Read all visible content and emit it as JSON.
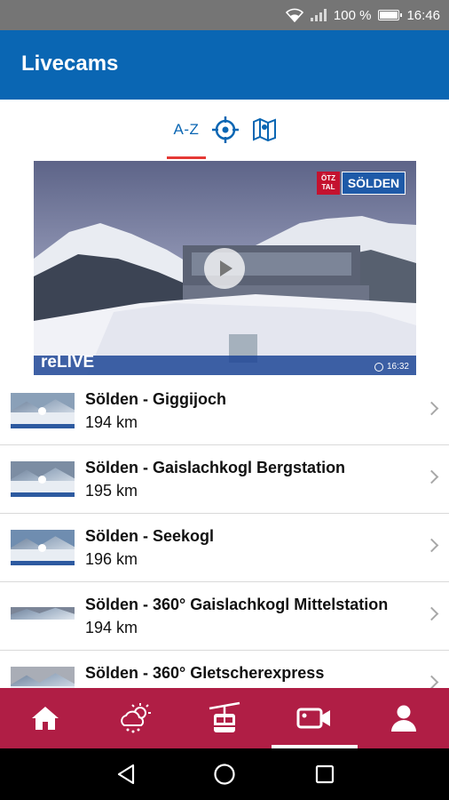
{
  "status_bar": {
    "battery_text": "100 %",
    "time": "16:46",
    "icons": [
      "wifi-icon",
      "signal-icon",
      "battery-icon"
    ]
  },
  "app_bar": {
    "title": "Livecams"
  },
  "view_tabs": [
    {
      "label": "A-Z",
      "selected": true
    },
    {
      "icon": "locate-icon",
      "selected": false
    },
    {
      "icon": "map-icon",
      "selected": false
    }
  ],
  "featured_cam": {
    "brand_small": "ÖTZ TAL",
    "brand": "SÖLDEN",
    "overlay_label": "reLIVE",
    "time": "16:32"
  },
  "cams": [
    {
      "title": "Sölden - Giggijoch",
      "distance": "194 km"
    },
    {
      "title": "Sölden - Gaislachkogl Bergstation",
      "distance": "195 km"
    },
    {
      "title": "Sölden - Seekogl",
      "distance": "196 km"
    },
    {
      "title": "Sölden - 360° Gaislachkogl Mittelstation",
      "distance": "194 km"
    },
    {
      "title": "Sölden - 360° Gletscherexpress",
      "distance": ""
    }
  ],
  "bottom_nav": [
    {
      "icon": "home-icon",
      "active": false
    },
    {
      "icon": "weather-icon",
      "active": false
    },
    {
      "icon": "gondola-icon",
      "active": false
    },
    {
      "icon": "camera-icon",
      "active": true
    },
    {
      "icon": "profile-icon",
      "active": false
    }
  ],
  "colors": {
    "app_bar": "#0a66b3",
    "accent_underline": "#e53935",
    "bottom_nav": "#b01e45",
    "status_bar": "#757575"
  }
}
